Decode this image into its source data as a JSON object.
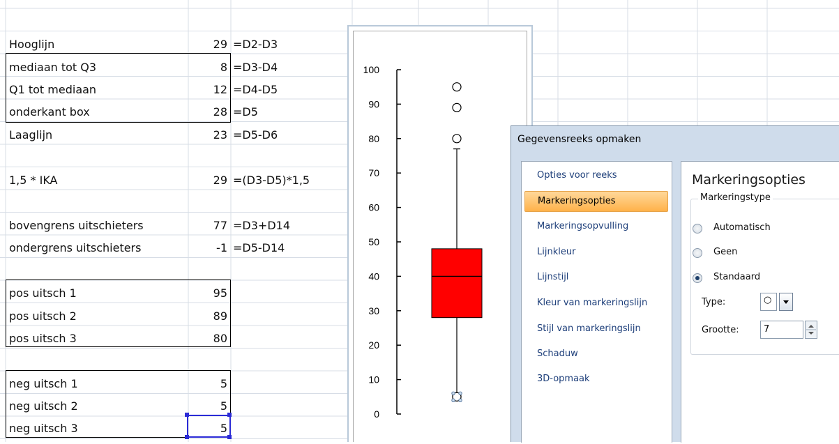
{
  "rows": [
    {
      "label": "Hooglijn",
      "value": "29",
      "formula": "=D2-D3"
    },
    {
      "label": "mediaan tot  Q3",
      "value": "8",
      "formula": "=D3-D4"
    },
    {
      "label": "Q1 tot mediaan",
      "value": "12",
      "formula": "=D4-D5"
    },
    {
      "label": "onderkant box",
      "value": "28",
      "formula": "=D5"
    },
    {
      "label": "Laaglijn",
      "value": "23",
      "formula": "=D5-D6"
    },
    {
      "label": "1,5 * IKA",
      "value": "29",
      "formula": "=(D3-D5)*1,5"
    },
    {
      "label": "bovengrens uitschieters",
      "value": "77",
      "formula": "=D3+D14"
    },
    {
      "label": "ondergrens uitschieters",
      "value": "-1",
      "formula": "=D5-D14"
    },
    {
      "label": "pos uitsch 1",
      "value": "95",
      "formula": ""
    },
    {
      "label": "pos uitsch 2",
      "value": "89",
      "formula": ""
    },
    {
      "label": "pos uitsch 3",
      "value": "80",
      "formula": ""
    },
    {
      "label": "neg uitsch 1",
      "value": "5",
      "formula": ""
    },
    {
      "label": "neg uitsch 2",
      "value": "5",
      "formula": ""
    },
    {
      "label": "neg uitsch 3",
      "value": "5",
      "formula": ""
    }
  ],
  "chart_data": {
    "type": "box",
    "title": "",
    "xlabel": "",
    "ylabel": "",
    "ylim": [
      0,
      100
    ],
    "yticks": [
      "0",
      "10",
      "20",
      "30",
      "40",
      "50",
      "60",
      "70",
      "80",
      "90",
      "100"
    ],
    "box": {
      "q1": 28,
      "median": 40,
      "q3": 48,
      "whisker_low": 5,
      "whisker_high": 77,
      "color": "#ff0000"
    },
    "outliers_high": [
      95,
      89,
      80
    ],
    "outliers_low": [
      5,
      5,
      5
    ]
  },
  "dialog": {
    "title": "Gegevensreeks opmaken",
    "nav": [
      "Opties voor reeks",
      "Markeringsopties",
      "Markeringsopvulling",
      "Lijnkleur",
      "Lijnstijl",
      "Kleur van markeringslijn",
      "Stijl van markeringslijn",
      "Schaduw",
      "3D-opmaak"
    ],
    "active_nav": "Markeringsopties",
    "panel_title": "Markeringsopties",
    "group_title": "Markeringstype",
    "options": [
      "Automatisch",
      "Geen",
      "Standaard"
    ],
    "selected_option": "Standaard",
    "type_label": "Type:",
    "type_value": "○",
    "size_label": "Grootte:",
    "size_value": "7"
  },
  "colors": {
    "selection": "#2b2bd6",
    "nav_active": "#ffb24a",
    "dialog_bg": "#cfdceb",
    "box_fill": "#ff0000"
  }
}
